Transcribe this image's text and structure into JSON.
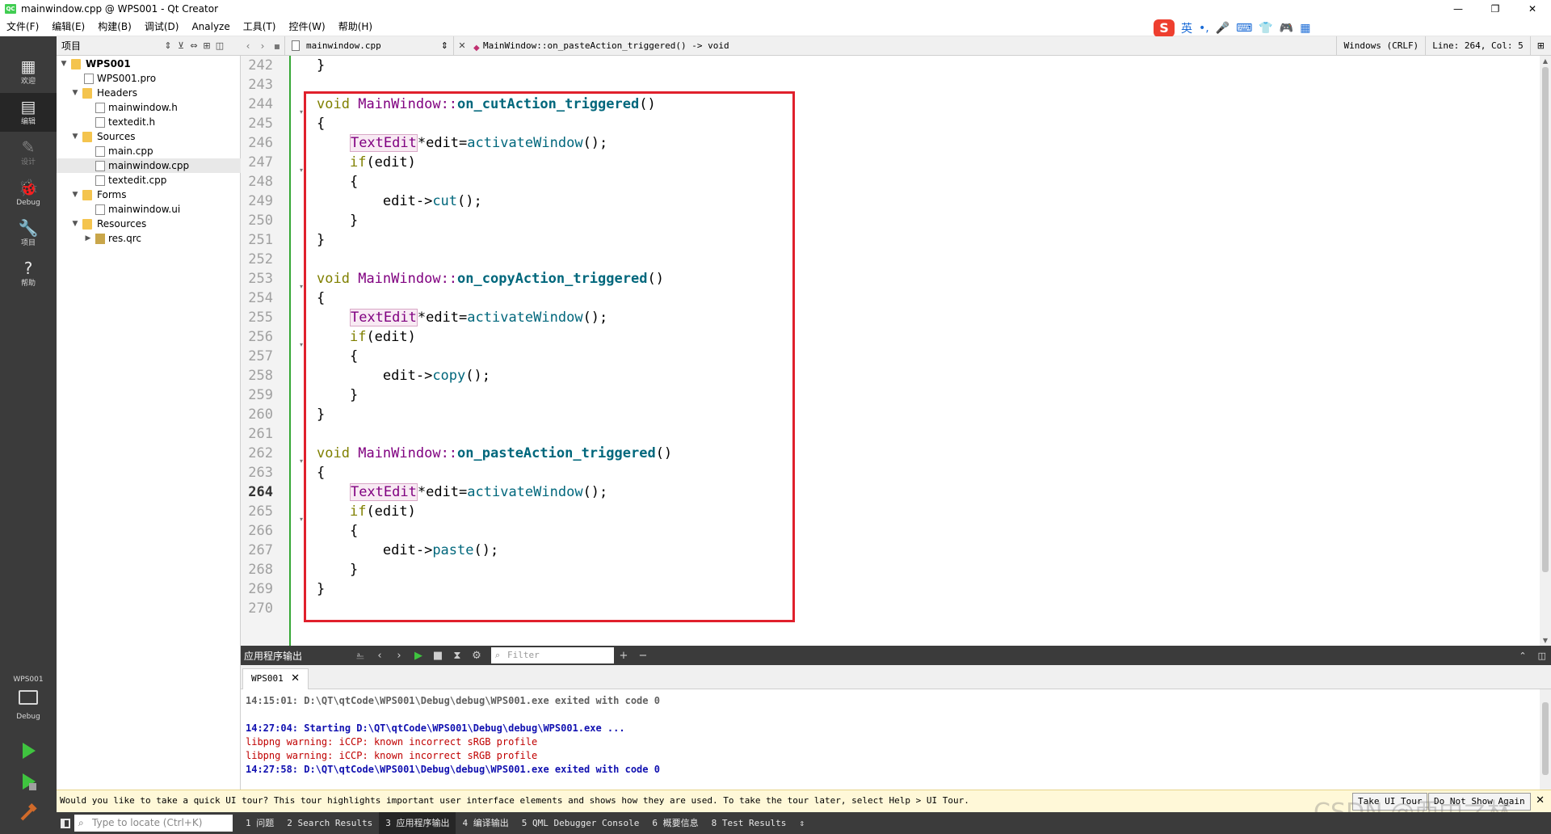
{
  "window": {
    "title": "mainwindow.cpp @ WPS001 - Qt Creator",
    "app_icon_text": "QC",
    "minimize": "—",
    "maximize": "❐",
    "close": "✕"
  },
  "menu": [
    "文件(F)",
    "编辑(E)",
    "构建(B)",
    "调试(D)",
    "Analyze",
    "工具(T)",
    "控件(W)",
    "帮助(H)"
  ],
  "ime": {
    "logo": "S",
    "items": [
      "英",
      "•,",
      "🎤",
      "⌨",
      "👕",
      "🎮",
      "▦"
    ]
  },
  "modes": [
    {
      "icon": "▦",
      "label": "欢迎"
    },
    {
      "icon": "▤",
      "label": "编辑"
    },
    {
      "icon": "✎",
      "label": "设计"
    },
    {
      "icon": "🐞",
      "label": "Debug"
    },
    {
      "icon": "🔧",
      "label": "项目"
    },
    {
      "icon": "?",
      "label": "帮助"
    }
  ],
  "kit": {
    "project": "WPS001",
    "config": "Debug"
  },
  "project_panel": {
    "combo": "项目",
    "combo_arrow": "⇕",
    "filter_icon": "⊻",
    "link_icon": "⇔",
    "split_icon": "⊞",
    "close_icon": "◫"
  },
  "tree": [
    {
      "label": "WPS001",
      "bold": true
    },
    {
      "label": "WPS001.pro"
    },
    {
      "label": "Headers"
    },
    {
      "label": "mainwindow.h"
    },
    {
      "label": "textedit.h"
    },
    {
      "label": "Sources"
    },
    {
      "label": "main.cpp"
    },
    {
      "label": "mainwindow.cpp",
      "selected": true
    },
    {
      "label": "textedit.cpp"
    },
    {
      "label": "Forms"
    },
    {
      "label": "mainwindow.ui"
    },
    {
      "label": "Resources"
    },
    {
      "label": "res.qrc"
    }
  ],
  "editor_bar": {
    "back": "‹",
    "forward": "›",
    "file": "mainwindow.cpp",
    "file_arrow": "⇕",
    "close": "✕",
    "symbol_icon": "◆",
    "symbol": "MainWindow::on_pasteAction_triggered() -> void",
    "line_ending": "Windows (CRLF)",
    "position": "Line: 264, Col: 5",
    "split": "⊞"
  },
  "line_numbers": [
    "242",
    "243",
    "244",
    "245",
    "246",
    "247",
    "248",
    "249",
    "250",
    "251",
    "252",
    "253",
    "254",
    "255",
    "256",
    "257",
    "258",
    "259",
    "260",
    "261",
    "262",
    "263",
    "264",
    "265",
    "266",
    "267",
    "268",
    "269",
    "270"
  ],
  "current_line": "264",
  "code": {
    "l242": "}",
    "kw_void": "void",
    "cls_mw": "MainWindow",
    "sep": "::",
    "fn_cut": "on_cutAction_triggered",
    "fn_copy": "on_copyAction_triggered",
    "fn_paste": "on_pasteAction_triggered",
    "parens": "()",
    "open_brace": "{",
    "close_brace": "}",
    "type_textedit": "TextEdit",
    "ptr_edit": "*edit=",
    "call_activate": "activateWindow",
    "call_end": "();",
    "kw_if": "if",
    "if_cond": "(edit)",
    "edit_arrow": "edit->",
    "call_cut": "cut",
    "call_copy": "copy",
    "call_paste": "paste"
  },
  "output": {
    "title": "应用程序输出",
    "filter_placeholder": "Filter",
    "tab": "WPS001",
    "tab_close": "✕",
    "lines": [
      "14:15:01: D:\\QT\\qtCode\\WPS001\\Debug\\debug\\WPS001.exe exited with code 0",
      "14:27:04: Starting D:\\QT\\qtCode\\WPS001\\Debug\\debug\\WPS001.exe ...",
      "libpng warning: iCCP: known incorrect sRGB profile",
      "libpng warning: iCCP: known incorrect sRGB profile",
      "14:27:58: D:\\QT\\qtCode\\WPS001\\Debug\\debug\\WPS001.exe exited with code 0"
    ]
  },
  "tour": {
    "message": "Would you like to take a quick UI tour? This tour highlights important user interface elements and shows how they are used. To take the tour later, select Help > UI Tour.",
    "take_button": "Take UI Tour",
    "dismiss_button": "Do Not Show Again",
    "close": "✕"
  },
  "watermark": "CSDN @西中之林",
  "status": {
    "locator_placeholder": "Type to locate (Ctrl+K)",
    "tabs": [
      "1 问题",
      "2 Search Results",
      "3 应用程序输出",
      "4 编译输出",
      "5 QML Debugger Console",
      "6 概要信息",
      "8 Test Results"
    ],
    "active_tab": "3 应用程序输出",
    "more": "⇕"
  }
}
